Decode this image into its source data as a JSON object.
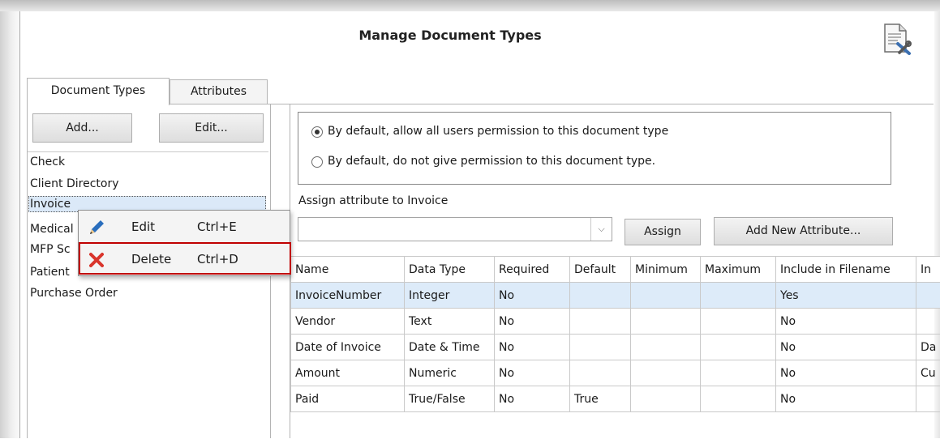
{
  "dialog": {
    "title": "Manage Document Types"
  },
  "tabs": [
    {
      "label": "Document Types",
      "active": true
    },
    {
      "label": "Attributes",
      "active": false
    }
  ],
  "left": {
    "add_label": "Add...",
    "edit_label": "Edit...",
    "items": [
      "Check",
      "Client Directory",
      "Invoice",
      "Medical",
      "MFP Sc",
      "Patient",
      "Purchase Order"
    ],
    "selected_index": 2
  },
  "permissions": {
    "option_allow": "By default, allow all users permission to this document type",
    "option_deny": "By default, do not give permission to this document type.",
    "selected": "allow"
  },
  "assign": {
    "label": "Assign attribute to Invoice",
    "combo_value": "",
    "assign_button": "Assign",
    "add_new_button": "Add New Attribute..."
  },
  "grid": {
    "columns": [
      "Name",
      "Data Type",
      "Required",
      "Default",
      "Minimum",
      "Maximum",
      "Include in Filename",
      "In"
    ],
    "rows": [
      [
        "InvoiceNumber",
        "Integer",
        "No",
        "",
        "",
        "",
        "Yes",
        ""
      ],
      [
        "Vendor",
        "Text",
        "No",
        "",
        "",
        "",
        "No",
        ""
      ],
      [
        "Date of Invoice",
        "Date & Time",
        "No",
        "",
        "",
        "",
        "No",
        "Da"
      ],
      [
        "Amount",
        "Numeric",
        "No",
        "",
        "",
        "",
        "No",
        "Cu"
      ],
      [
        "Paid",
        "True/False",
        "No",
        "True",
        "",
        "",
        "No",
        ""
      ]
    ],
    "selected_row": 0
  },
  "context_menu": {
    "items": [
      {
        "label": "Edit",
        "shortcut": "Ctrl+E",
        "icon": "pencil-icon"
      },
      {
        "label": "Delete",
        "shortcut": "Ctrl+D",
        "icon": "red-x-icon"
      }
    ],
    "highlighted": "Delete",
    "highlight_color": "#c00000"
  },
  "colors": {
    "selection": "#dbe9f8",
    "accent_pencil": "#2a6ebd",
    "delete_x": "#d9342b"
  }
}
